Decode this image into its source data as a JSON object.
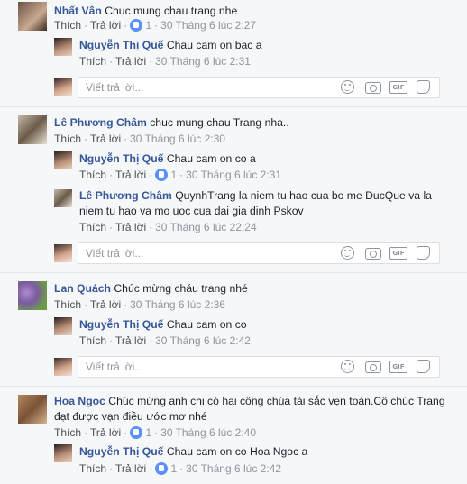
{
  "placeholder": "Viết trả lời...",
  "actions": {
    "like": "Thích",
    "reply": "Trả lời"
  },
  "reply_icons": [
    "emoji-icon",
    "camera-icon",
    "gif-icon",
    "sticker-icon"
  ],
  "gif_label": "GIF",
  "threads": [
    {
      "comment": {
        "author": "Nhất Vân",
        "text": "Chuc mung chau trang nhe",
        "likes": "1",
        "time": "30 Tháng 6 lúc 2:27"
      },
      "replies": [
        {
          "author": "Nguyễn Thị Quế",
          "text": "Chau cam on bac a",
          "likes": "",
          "time": "30 Tháng 6 lúc 2:31"
        }
      ]
    },
    {
      "comment": {
        "author": "Lê Phương Châm",
        "text": "chuc mung chau Trang nha..",
        "likes": "",
        "time": "30 Tháng 6 lúc 2:30"
      },
      "replies": [
        {
          "author": "Nguyễn Thị Quế",
          "text": "Chau cam on co a",
          "likes": "1",
          "time": "30 Tháng 6 lúc 2:31"
        },
        {
          "author": "Lê Phương Châm",
          "text": "QuynhTrang la niem tu hao cua bo me DucQue va la niem tu hao va mo uoc cua dai gia dinh Pskov",
          "likes": "",
          "time": "30 Tháng 6 lúc 22:24"
        }
      ]
    },
    {
      "comment": {
        "author": "Lan Quách",
        "text": "Chúc mừng cháu trang nhé",
        "likes": "",
        "time": "30 Tháng 6 lúc 2:36"
      },
      "replies": [
        {
          "author": "Nguyễn Thị Quế",
          "text": "Chau cam on co",
          "likes": "",
          "time": "30 Tháng 6 lúc 2:42"
        }
      ]
    },
    {
      "comment": {
        "author": "Hoa Ngọc",
        "text": "Chúc mừng anh chị có hai công chúa tài sắc vẹn toàn.Cô chúc Trang đạt được vạn điều ước mơ nhé",
        "likes": "1",
        "time": "30 Tháng 6 lúc 2:40"
      },
      "replies": [
        {
          "author": "Nguyễn Thị Quế",
          "text": "Chau cam on co Hoa Ngoc a",
          "likes": "1",
          "time": "30 Tháng 6 lúc 2:42"
        }
      ]
    }
  ]
}
